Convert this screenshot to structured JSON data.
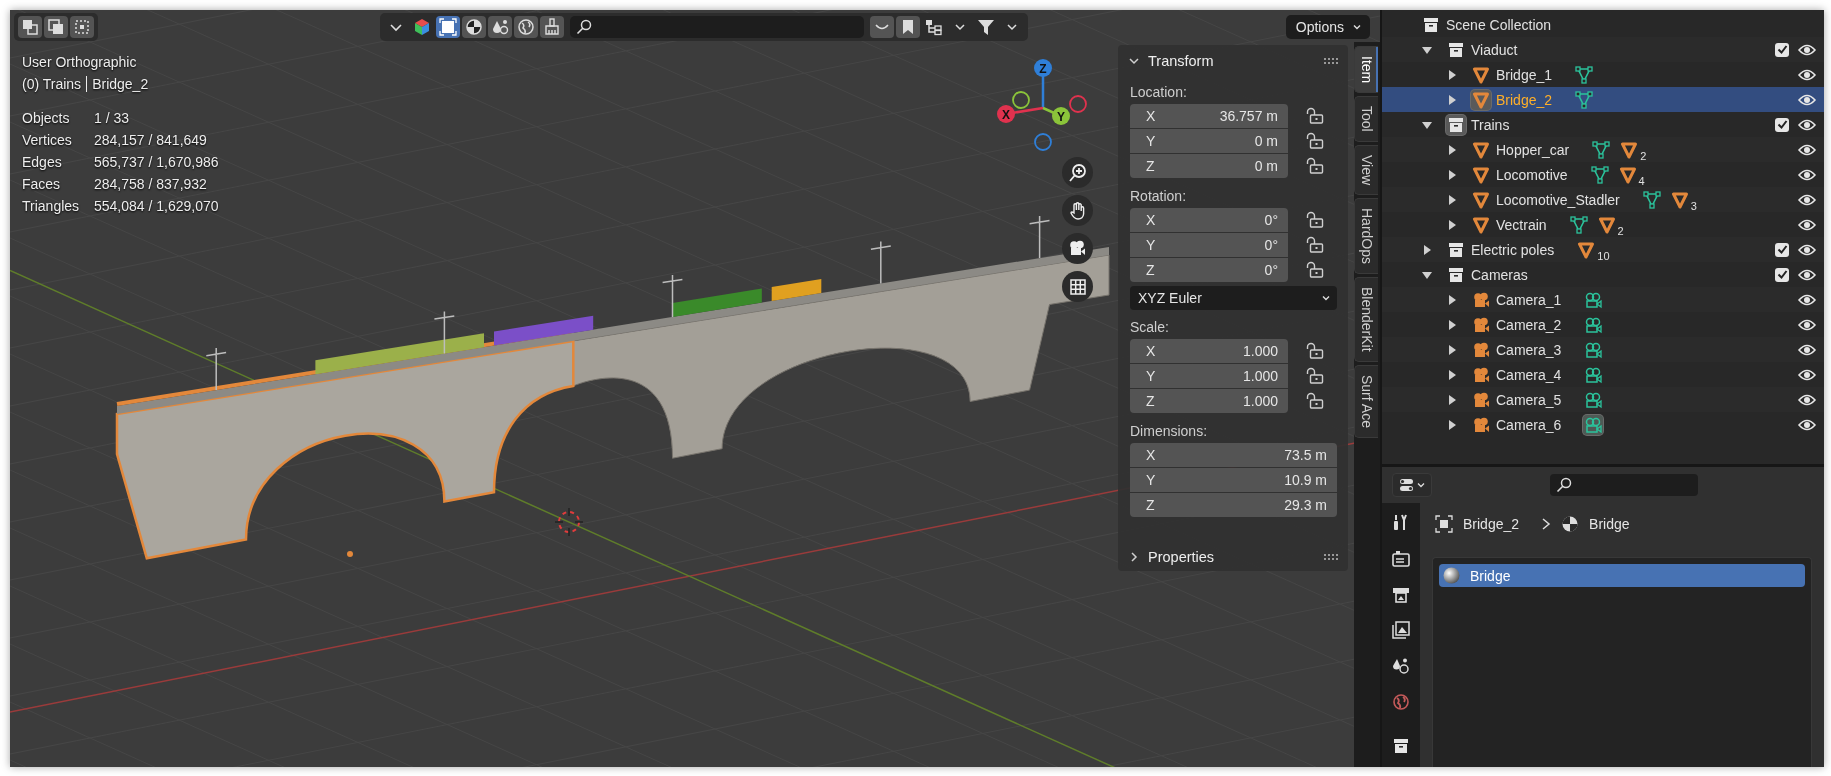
{
  "viewport": {
    "header": {
      "options_label": "Options"
    },
    "view_name": "User Orthographic",
    "context": {
      "collection": "(0) Trains",
      "object": "Bridge_2"
    },
    "stats": [
      {
        "label": "Objects",
        "value": "1 / 33"
      },
      {
        "label": "Vertices",
        "value": "284,157 / 841,649"
      },
      {
        "label": "Edges",
        "value": "565,737 / 1,670,986"
      },
      {
        "label": "Faces",
        "value": "284,758 / 837,932"
      },
      {
        "label": "Triangles",
        "value": "554,084 / 1,629,070"
      }
    ],
    "gizmo": [
      {
        "label": "Z",
        "color": "#2f7fd8"
      },
      {
        "label": "X",
        "color": "#e0324e"
      },
      {
        "label": "Y",
        "color": "#8bc43a"
      }
    ]
  },
  "sidebar": {
    "panels": [
      {
        "title": "Transform",
        "expanded": true,
        "groups": [
          {
            "label": "Location:",
            "fields": [
              {
                "axis": "X",
                "value": "36.757 m",
                "locked": false
              },
              {
                "axis": "Y",
                "value": "0 m",
                "locked": false
              },
              {
                "axis": "Z",
                "value": "0 m",
                "locked": false
              }
            ]
          },
          {
            "label": "Rotation:",
            "fields": [
              {
                "axis": "X",
                "value": "0°",
                "locked": false
              },
              {
                "axis": "Y",
                "value": "0°",
                "locked": false
              },
              {
                "axis": "Z",
                "value": "0°",
                "locked": false
              }
            ],
            "mode": "XYZ Euler"
          },
          {
            "label": "Scale:",
            "fields": [
              {
                "axis": "X",
                "value": "1.000",
                "locked": false
              },
              {
                "axis": "Y",
                "value": "1.000",
                "locked": false
              },
              {
                "axis": "Z",
                "value": "1.000",
                "locked": false
              }
            ]
          },
          {
            "label": "Dimensions:",
            "fields": [
              {
                "axis": "X",
                "value": "73.5 m"
              },
              {
                "axis": "Y",
                "value": "10.9 m"
              },
              {
                "axis": "Z",
                "value": "29.3 m"
              }
            ]
          }
        ]
      },
      {
        "title": "Properties",
        "expanded": false
      }
    ],
    "tabs": [
      {
        "label": "Item",
        "selected": true
      },
      {
        "label": "Tool",
        "selected": false
      },
      {
        "label": "View",
        "selected": false
      },
      {
        "label": "HardOps",
        "selected": false
      },
      {
        "label": "BlenderKit",
        "selected": false
      },
      {
        "label": "Surf Ace",
        "selected": false
      }
    ]
  },
  "outliner": {
    "items": [
      {
        "name": "Scene Collection",
        "kind": "scene",
        "selected": false,
        "active": false,
        "children": [
          {
            "name": "Viaduct",
            "kind": "collection",
            "expanded": true,
            "selected": false,
            "active": false,
            "checked": true,
            "visible": true,
            "children": [
              {
                "name": "Bridge_1",
                "kind": "mesh",
                "expanded": false,
                "selected": false,
                "active": false,
                "visible": true,
                "badges": [
                  {
                    "kind": "mesh_data"
                  }
                ]
              },
              {
                "name": "Bridge_2",
                "kind": "mesh",
                "expanded": false,
                "selected": true,
                "active": true,
                "visible": true,
                "badges": [
                  {
                    "kind": "mesh_data"
                  }
                ]
              }
            ]
          },
          {
            "name": "Trains",
            "kind": "collection",
            "expanded": true,
            "selected": false,
            "active": true,
            "checked": true,
            "visible": true,
            "children": [
              {
                "name": "Hopper_car",
                "kind": "mesh",
                "expanded": false,
                "selected": false,
                "active": false,
                "visible": true,
                "badges": [
                  {
                    "kind": "mesh_data"
                  },
                  {
                    "kind": "mesh",
                    "count": "2"
                  }
                ]
              },
              {
                "name": "Locomotive",
                "kind": "mesh",
                "expanded": false,
                "selected": false,
                "active": false,
                "visible": true,
                "badges": [
                  {
                    "kind": "mesh_data"
                  },
                  {
                    "kind": "mesh",
                    "count": "4"
                  }
                ]
              },
              {
                "name": "Locomotive_Stadler",
                "kind": "mesh",
                "expanded": false,
                "selected": false,
                "active": false,
                "visible": true,
                "badges": [
                  {
                    "kind": "mesh_data"
                  },
                  {
                    "kind": "mesh",
                    "count": "3"
                  }
                ]
              },
              {
                "name": "Vectrain",
                "kind": "mesh",
                "expanded": false,
                "selected": false,
                "active": false,
                "visible": true,
                "badges": [
                  {
                    "kind": "mesh_data"
                  },
                  {
                    "kind": "mesh",
                    "count": "2"
                  }
                ]
              }
            ]
          },
          {
            "name": "Electric poles",
            "kind": "collection",
            "expanded": false,
            "selected": false,
            "active": false,
            "checked": true,
            "visible": true,
            "badges": [
              {
                "kind": "mesh",
                "count": "10"
              }
            ]
          },
          {
            "name": "Cameras",
            "kind": "collection",
            "expanded": true,
            "selected": false,
            "active": false,
            "checked": true,
            "visible": true,
            "children": [
              {
                "name": "Camera_1",
                "kind": "camera",
                "expanded": false,
                "selected": false,
                "active": false,
                "visible": true,
                "badges": [
                  {
                    "kind": "camera_data",
                    "active": false
                  }
                ]
              },
              {
                "name": "Camera_2",
                "kind": "camera",
                "expanded": false,
                "selected": false,
                "active": false,
                "visible": true,
                "badges": [
                  {
                    "kind": "camera_data",
                    "active": false
                  }
                ]
              },
              {
                "name": "Camera_3",
                "kind": "camera",
                "expanded": false,
                "selected": false,
                "active": false,
                "visible": true,
                "badges": [
                  {
                    "kind": "camera_data",
                    "active": false
                  }
                ]
              },
              {
                "name": "Camera_4",
                "kind": "camera",
                "expanded": false,
                "selected": false,
                "active": false,
                "visible": true,
                "badges": [
                  {
                    "kind": "camera_data",
                    "active": false
                  }
                ]
              },
              {
                "name": "Camera_5",
                "kind": "camera",
                "expanded": false,
                "selected": false,
                "active": false,
                "visible": true,
                "badges": [
                  {
                    "kind": "camera_data",
                    "active": false
                  }
                ]
              },
              {
                "name": "Camera_6",
                "kind": "camera",
                "expanded": false,
                "selected": false,
                "active": false,
                "visible": true,
                "badges": [
                  {
                    "kind": "camera_data",
                    "active": true
                  }
                ]
              }
            ]
          }
        ]
      }
    ]
  },
  "properties": {
    "breadcrumb": {
      "object": "Bridge_2",
      "material": "Bridge"
    },
    "material_slots": [
      {
        "name": "Bridge",
        "selected": true
      }
    ]
  }
}
